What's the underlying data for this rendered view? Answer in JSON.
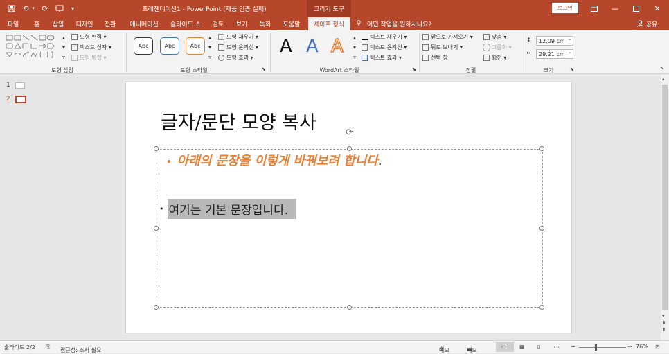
{
  "titlebar": {
    "title": "프레젠테이션1  -  PowerPoint (제품 인증 실패)",
    "drawing_tools": "그리기 도구",
    "login": "로그인"
  },
  "tabs": [
    "파일",
    "홈",
    "삽입",
    "디자인",
    "전환",
    "애니메이션",
    "슬라이드 쇼",
    "검토",
    "보기",
    "녹화",
    "도움말",
    "셰이프 형식"
  ],
  "tell_me": "어떤 작업을 원하시나요?",
  "share": "공유",
  "ribbon": {
    "insert_shapes": {
      "label": "도형 삽입",
      "edit_shape": "도형 편집",
      "text_box": "텍스트 상자",
      "merge_shapes": "도형 병합"
    },
    "shape_styles": {
      "label": "도형 스타일",
      "sample": "Abc",
      "fill": "도형 채우기",
      "outline": "도형 윤곽선",
      "effects": "도형 효과"
    },
    "wordart": {
      "label": "WordArt 스타일",
      "letter": "A",
      "text_fill": "텍스트 채우기",
      "text_outline": "텍스트 윤곽선",
      "text_effects": "텍스트 효과"
    },
    "arrange": {
      "label": "정렬",
      "bring_forward": "앞으로 가져오기",
      "send_backward": "뒤로 보내기",
      "selection_pane": "선택 창",
      "align": "맞춤",
      "group": "그룹화",
      "rotate": "회전"
    },
    "size": {
      "label": "크기",
      "height": "12.09 cm",
      "width": "29.21 cm"
    }
  },
  "thumbnails": [
    "1",
    "2"
  ],
  "slide": {
    "title": "글자/문단 모양 복사",
    "bullet1": "아래의 문장을 이렇게 바꿔보려 합니다",
    "bullet1_end": ".",
    "bullet2": "여기는 기본 문장입니다."
  },
  "status": {
    "slide": "슬라이드 2/2",
    "accessibility": "접근성: 조사 필요",
    "notes": "메모",
    "comments": "메모",
    "zoom": "76%"
  },
  "colors": {
    "accent": "#b7472a",
    "orange_text": "#ed7d31",
    "highlight": "#b8b8b8"
  }
}
